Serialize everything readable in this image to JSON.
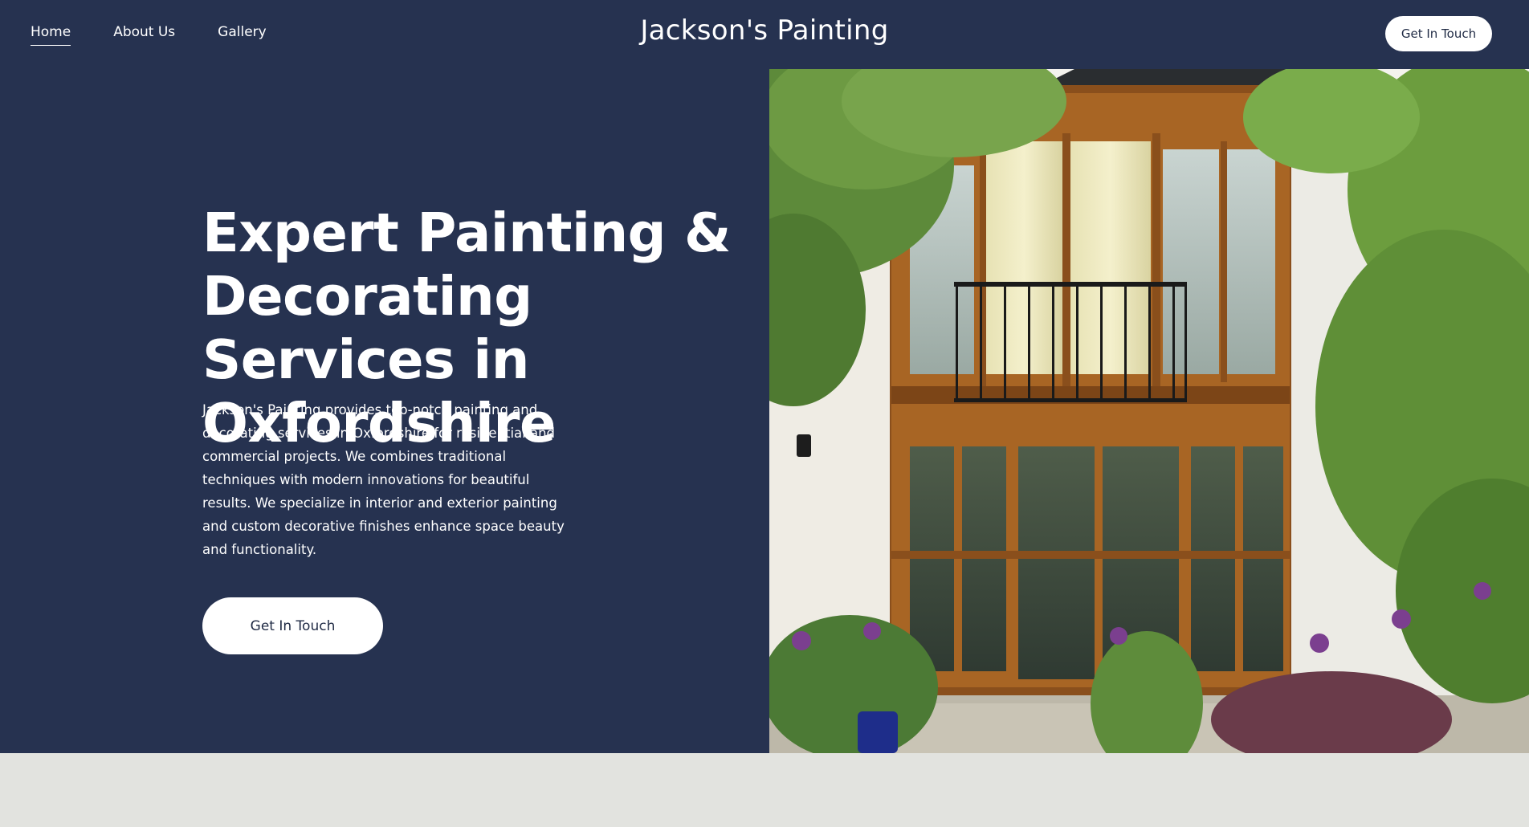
{
  "header": {
    "nav": [
      {
        "label": "Home",
        "active": true
      },
      {
        "label": "About Us",
        "active": false
      },
      {
        "label": "Gallery",
        "active": false
      }
    ],
    "brand": "Jackson's Painting",
    "cta_label": "Get In Touch"
  },
  "hero": {
    "headline": "Expert Painting & Decorating Services in Oxfordshire",
    "description": "Jackson's Painting provides top-notch painting and decorating services in Oxfordshire for residential and commercial projects. We combines traditional techniques with modern innovations for beautiful results. We specialize in interior and exterior painting and custom decorative finishes enhance space beauty and functionality.",
    "cta_label": "Get In Touch",
    "image_icon": "house-photo"
  },
  "colors": {
    "navy": "#263250",
    "white": "#ffffff",
    "light_band": "#e2e3df",
    "button_text": "#1f2a44"
  }
}
